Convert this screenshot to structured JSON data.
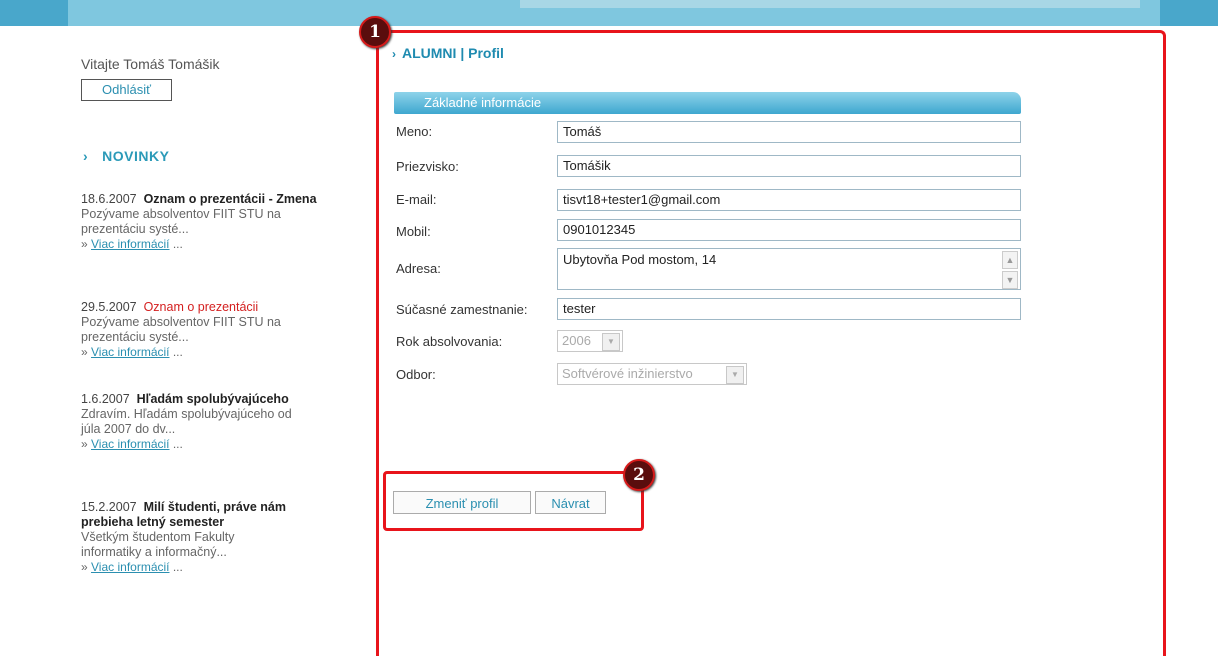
{
  "sidebar": {
    "welcome": "Vitajte Tomáš Tomášik",
    "logout_label": "Odhlásiť",
    "news_heading": "NOVINKY",
    "news": [
      {
        "date": "18.6.2007",
        "title": "Oznam o prezentácii - Zmena",
        "text": "Pozývame absolventov FIIT STU na prezentáciu systé...",
        "more": "Viac informácií"
      },
      {
        "date": "29.5.2007",
        "title": "Oznam o prezentácii",
        "text": "Pozývame absolventov FIIT STU na prezentáciu systé...",
        "more": "Viac informácií"
      },
      {
        "date": "1.6.2007",
        "title": "Hľadám spolubývajúceho",
        "text": "Zdravím. Hľadám spolubývajúceho od júla 2007 do dv...",
        "more": "Viac informácií"
      },
      {
        "date": "15.2.2007",
        "title": "Milí študenti, práve nám prebieha letný semester",
        "text": "Všetkým študentom Fakulty informatiky a informačný...",
        "more": "Viac informácií"
      }
    ]
  },
  "main": {
    "title": "ALUMNI | Profil",
    "section": "Základné informácie",
    "fields": {
      "meno": {
        "label": "Meno:",
        "value": "Tomáš"
      },
      "priezvisko": {
        "label": "Priezvisko:",
        "value": "Tomášik"
      },
      "email": {
        "label": "E-mail:",
        "value": "tisvt18+tester1@gmail.com"
      },
      "mobil": {
        "label": "Mobil:",
        "value": "0901012345"
      },
      "adresa": {
        "label": "Adresa:",
        "value": "Ubytovňa Pod mostom, 14"
      },
      "zamestnanie": {
        "label": "Súčasné zamestnanie:",
        "value": "tester"
      },
      "rok": {
        "label": "Rok absolvovania:",
        "value": "2006"
      },
      "odbor": {
        "label": "Odbor:",
        "value": "Softvérové inžinierstvo"
      }
    },
    "buttons": {
      "change": "Zmeniť profil",
      "back": "Návrat"
    }
  },
  "annotations": {
    "badge1": "1",
    "badge2": "2"
  },
  "colors": {
    "accent": "#2b9ab8",
    "highlight": "#e8141b",
    "header": "#7fc7df"
  }
}
